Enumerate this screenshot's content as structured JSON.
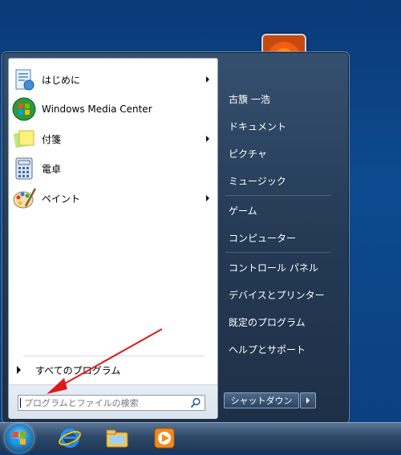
{
  "programs": [
    {
      "label": "はじめに",
      "has_submenu": true
    },
    {
      "label": "Windows Media Center",
      "has_submenu": false
    },
    {
      "label": "付箋",
      "has_submenu": true
    },
    {
      "label": "電卓",
      "has_submenu": false
    },
    {
      "label": "ペイント",
      "has_submenu": true
    }
  ],
  "all_programs_label": "すべてのプログラム",
  "search": {
    "placeholder": "プログラムとファイルの検索"
  },
  "right_menu": {
    "items": [
      "古籏 一浩",
      "ドキュメント",
      "ピクチャ",
      "ミュージック",
      "ゲーム",
      "コンピューター",
      "コントロール パネル",
      "デバイスとプリンター",
      "既定のプログラム",
      "ヘルプとサポート"
    ]
  },
  "shutdown": {
    "label": "シャットダウン"
  },
  "taskbar": {
    "icons": [
      "start-orb",
      "internet-explorer-icon",
      "windows-explorer-icon",
      "media-player-icon"
    ]
  },
  "colors": {
    "annotation_arrow": "#e01818"
  }
}
